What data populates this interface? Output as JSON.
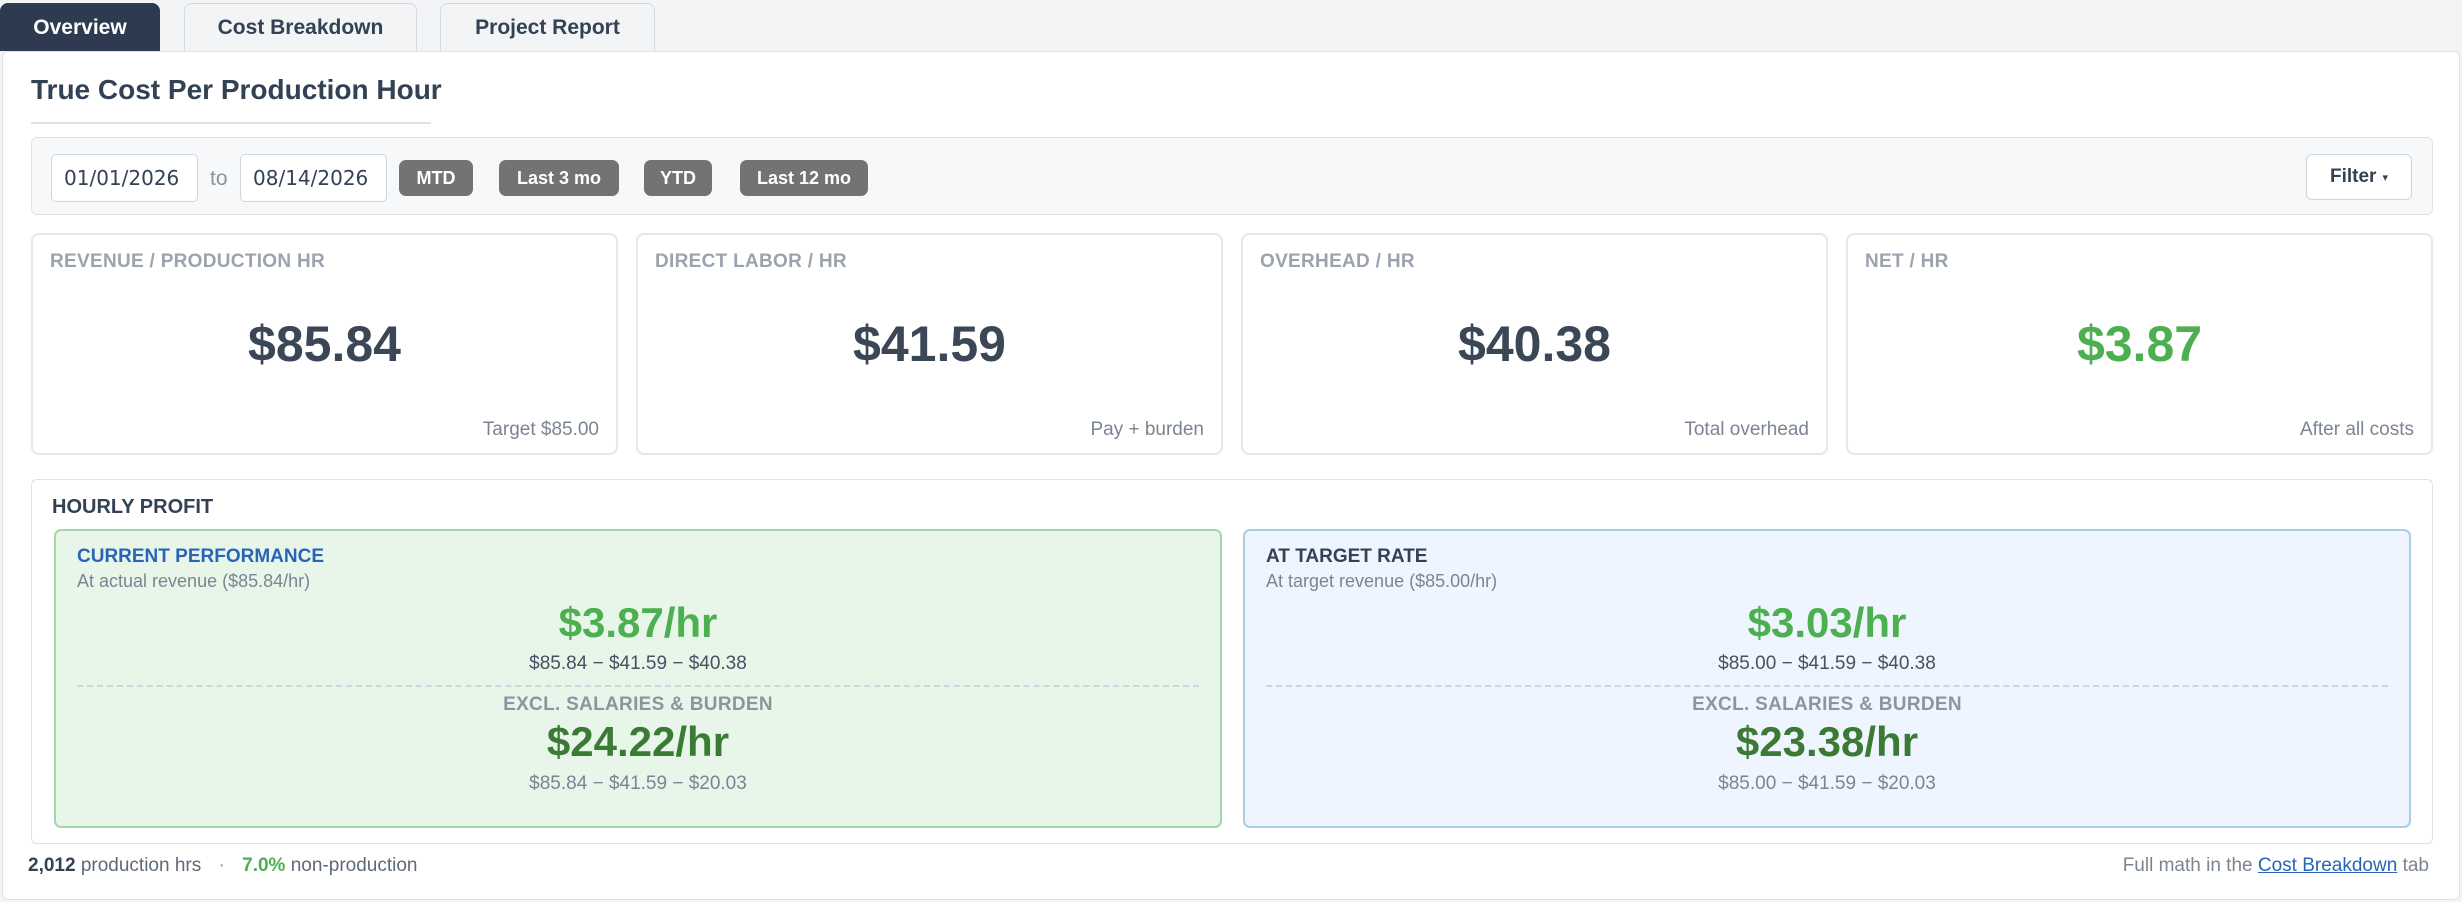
{
  "tabs": {
    "overview": "Overview",
    "cost_breakdown": "Cost Breakdown",
    "project_report": "Project Report"
  },
  "page": {
    "title": "True Cost Per Production Hour"
  },
  "filters": {
    "date_from": "01/01/2026",
    "to_label": "to",
    "date_to": "08/14/2026",
    "presets": [
      "MTD",
      "Last 3 mo",
      "YTD",
      "Last 12 mo"
    ],
    "filter_label": "Filter",
    "filter_caret": "▾"
  },
  "kpis": [
    {
      "label": "REVENUE / PRODUCTION HR",
      "value": "$85.84",
      "sub": "Target $85.00"
    },
    {
      "label": "DIRECT LABOR / HR",
      "value": "$41.59",
      "sub": "Pay + burden"
    },
    {
      "label": "OVERHEAD / HR",
      "value": "$40.38",
      "sub": "Total overhead"
    },
    {
      "label": "NET / HR",
      "value": "$3.87",
      "sub": "After all costs"
    }
  ],
  "hourly_profit": {
    "title": "HOURLY PROFIT",
    "current": {
      "title": "CURRENT PERFORMANCE",
      "subtitle": "At actual revenue ($85.84/hr)",
      "rate": "$3.87/hr",
      "math": "$85.84 − $41.59 − $40.38",
      "excl_label": "EXCL. SALARIES & BURDEN",
      "excl_rate": "$24.22/hr",
      "excl_math": "$85.84 − $41.59 − $20.03"
    },
    "target": {
      "title": "AT TARGET RATE",
      "subtitle": "At target revenue ($85.00/hr)",
      "rate": "$3.03/hr",
      "math": "$85.00 − $41.59 − $40.38",
      "excl_label": "EXCL. SALARIES & BURDEN",
      "excl_rate": "$23.38/hr",
      "excl_math": "$85.00 − $41.59 − $20.03"
    }
  },
  "footer": {
    "production_hours": "2,012",
    "production_hours_label": "production hrs",
    "separator": "·",
    "non_production_pct": "7.0%",
    "non_production_label": "non-production",
    "math_prefix": "Full math in the",
    "math_link": "Cost Breakdown",
    "math_suffix": "tab"
  },
  "colors": {
    "active_tab": "#2d3a4f",
    "positive": "#4caf50",
    "positive_dark": "#3b7a35",
    "link": "#2a64b8",
    "chip": "#737373"
  }
}
